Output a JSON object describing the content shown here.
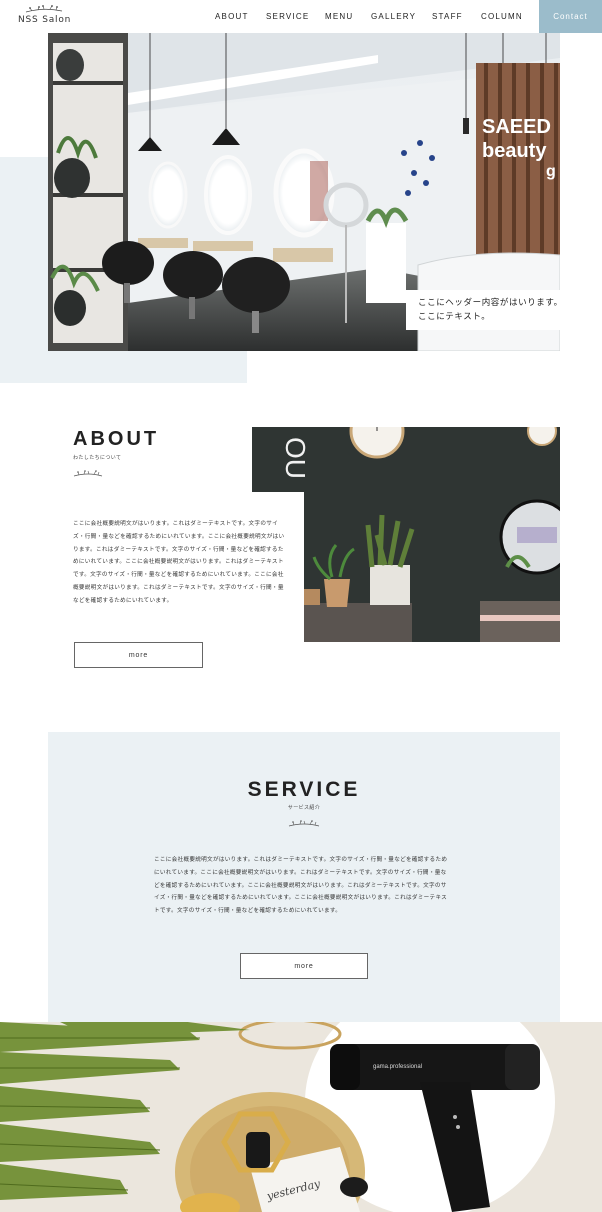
{
  "header": {
    "logo_text": "NSS Salon",
    "nav": [
      "ABOUT",
      "SERVICE",
      "MENU",
      "GALLERY",
      "STAFF",
      "COLUMN"
    ],
    "contact_label": "Contact",
    "accent_color": "#9bbccb"
  },
  "hero": {
    "sign_line1": "SAEED",
    "sign_line2": "beauty",
    "sign_line3": "g",
    "caption_line1": "ここにヘッダー内容がはいります。",
    "caption_line2": "ここにテキスト。"
  },
  "about": {
    "title": "ABOUT",
    "subtitle": "わたしたちについて",
    "wall_text": "OU",
    "text": "ここに会社概要説明文がはいります。これはダミーテキストです。文字のサイズ・行間・量などを確認するためにいれています。ここに会社概要説明文がはいります。これはダミーテキストです。文字のサイズ・行間・量などを確認するためにいれています。ここに会社概要説明文がはいります。これはダミーテキストです。文字のサイズ・行間・量などを確認するためにいれています。ここに会社概要説明文がはいります。これはダミーテキストです。文字のサイズ・行間・量などを確認するためにいれています。",
    "button_label": "more"
  },
  "service": {
    "title": "SERVICE",
    "subtitle": "サービス紹介",
    "text": "ここに会社概要説明文がはいります。これはダミーテキストです。文字のサイズ・行間・量などを確認するためにいれています。ここに会社概要説明文がはいります。これはダミーテキストです。文字のサイズ・行間・量などを確認するためにいれています。ここに会社概要説明文がはいります。これはダミーテキストです。文字のサイズ・行間・量などを確認するためにいれています。ここに会社概要説明文がはいります。これはダミーテキストです。文字のサイズ・行間・量などを確認するためにいれています。",
    "button_label": "more",
    "bg_color": "#ebf1f4"
  },
  "bottom": {
    "dryer_brand": "gama.professional",
    "magazine_text": "yesterday"
  }
}
